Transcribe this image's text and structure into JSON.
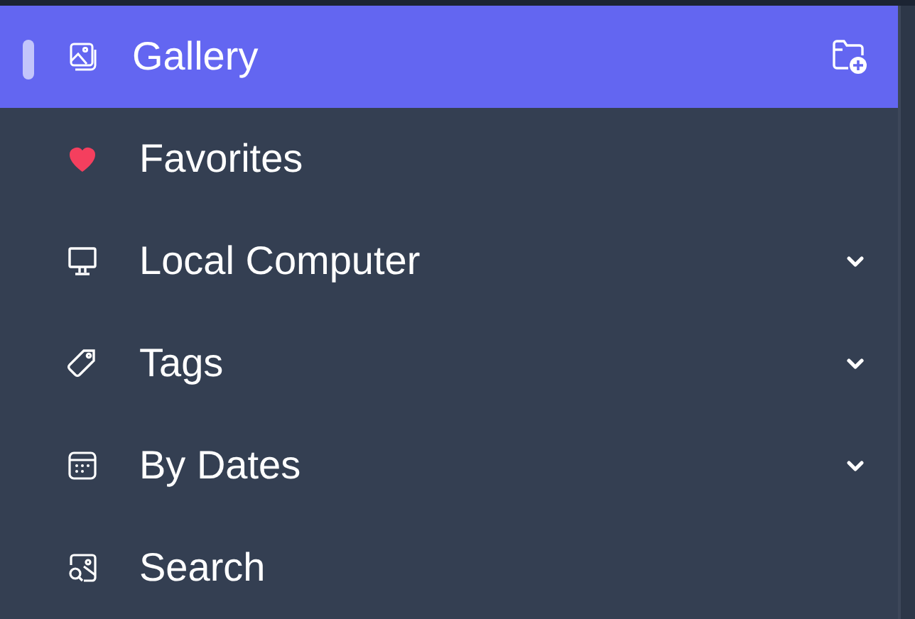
{
  "sidebar": {
    "items": [
      {
        "label": "Gallery",
        "selected": true,
        "expandable": false,
        "add_button": true
      },
      {
        "label": "Favorites",
        "selected": false,
        "expandable": false,
        "add_button": false
      },
      {
        "label": "Local Computer",
        "selected": false,
        "expandable": true,
        "add_button": false
      },
      {
        "label": "Tags",
        "selected": false,
        "expandable": true,
        "add_button": false
      },
      {
        "label": "By Dates",
        "selected": false,
        "expandable": true,
        "add_button": false
      },
      {
        "label": "Search",
        "selected": false,
        "expandable": false,
        "add_button": false
      }
    ]
  }
}
